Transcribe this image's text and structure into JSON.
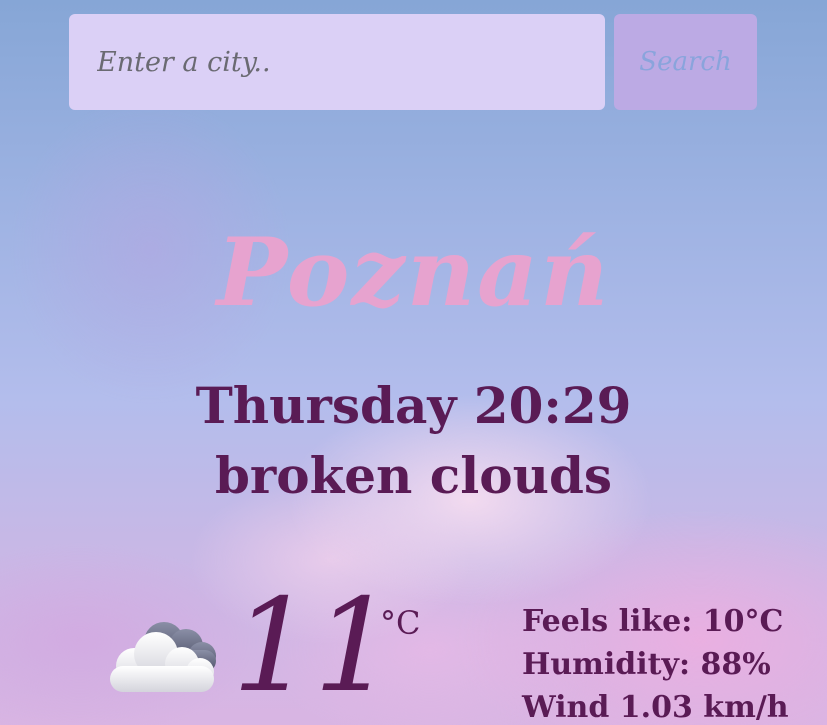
{
  "search": {
    "placeholder": "Enter a city..",
    "value": "",
    "button_label": "Search"
  },
  "weather": {
    "city": "Poznań",
    "datetime": "Thursday 20:29",
    "description": "broken clouds",
    "icon": "broken-clouds-icon",
    "temperature": "11",
    "unit": "°C",
    "feels_like": "Feels like: 10°C",
    "humidity": "Humidity: 88%",
    "wind": "Wind 1.03 km/h"
  },
  "colors": {
    "text": "#5a1b55",
    "city": "#e7a3cf",
    "input_bg": "#dbd0f6",
    "button_bg": "#bcaae4",
    "button_text": "#8aa4dc"
  }
}
